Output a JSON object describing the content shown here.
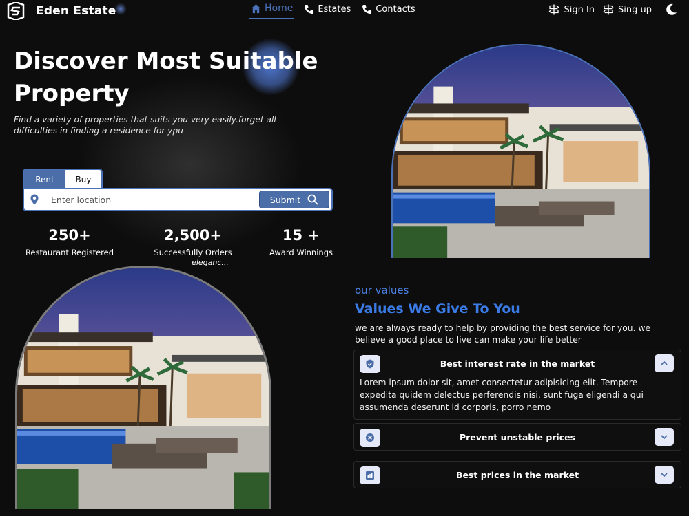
{
  "header": {
    "brand": "Eden Estate",
    "nav": [
      {
        "label": "Home",
        "icon": "home-icon",
        "active": true
      },
      {
        "label": "Estates",
        "icon": "phone-icon",
        "active": false
      },
      {
        "label": "Contacts",
        "icon": "phone-icon",
        "active": false
      }
    ],
    "signin_label": "Sign In",
    "signup_label": "Sing up",
    "theme_icon": "moon-icon"
  },
  "hero": {
    "title": "Discover Most Suitable Property",
    "subtitle": "Find a variety of properties that suits you very easily.forget all difficulties in finding a residence for ypu",
    "tabs": [
      "Rent",
      "Buy"
    ],
    "active_tab": "Rent",
    "search_placeholder": "Enter location",
    "submit_label": "Submit"
  },
  "stats": [
    {
      "value": "250+",
      "label": "Restaurant Registered",
      "sub": ""
    },
    {
      "value": "2,500+",
      "label": "Successfully Orders",
      "sub": "eleganc..."
    },
    {
      "value": "15 +",
      "label": "Award Winnings",
      "sub": ""
    }
  ],
  "values": {
    "kicker": "our values",
    "title": "Values We Give To You",
    "description": "we are always ready to help by providing the best service for you. we believe a good place to live can make your life better",
    "items": [
      {
        "title": "Best interest rate in the market",
        "icon": "shield-check-icon",
        "expanded": true,
        "body": "Lorem ipsum dolor sit, amet consectetur adipisicing elit. Tempore expedita quidem delectus perferendis nisi, sunt fuga eligendi a qui assumenda deserunt id corporis, porro nemo"
      },
      {
        "title": "Prevent unstable prices",
        "icon": "x-circle-icon",
        "expanded": false,
        "body": ""
      },
      {
        "title": "Best prices in the market",
        "icon": "bar-chart-icon",
        "expanded": false,
        "body": ""
      }
    ]
  },
  "colors": {
    "background": "#0d0d0d",
    "accent": "#4b72b9",
    "title_blue": "#3a7be6",
    "icon_bg": "#e6e9f7"
  }
}
